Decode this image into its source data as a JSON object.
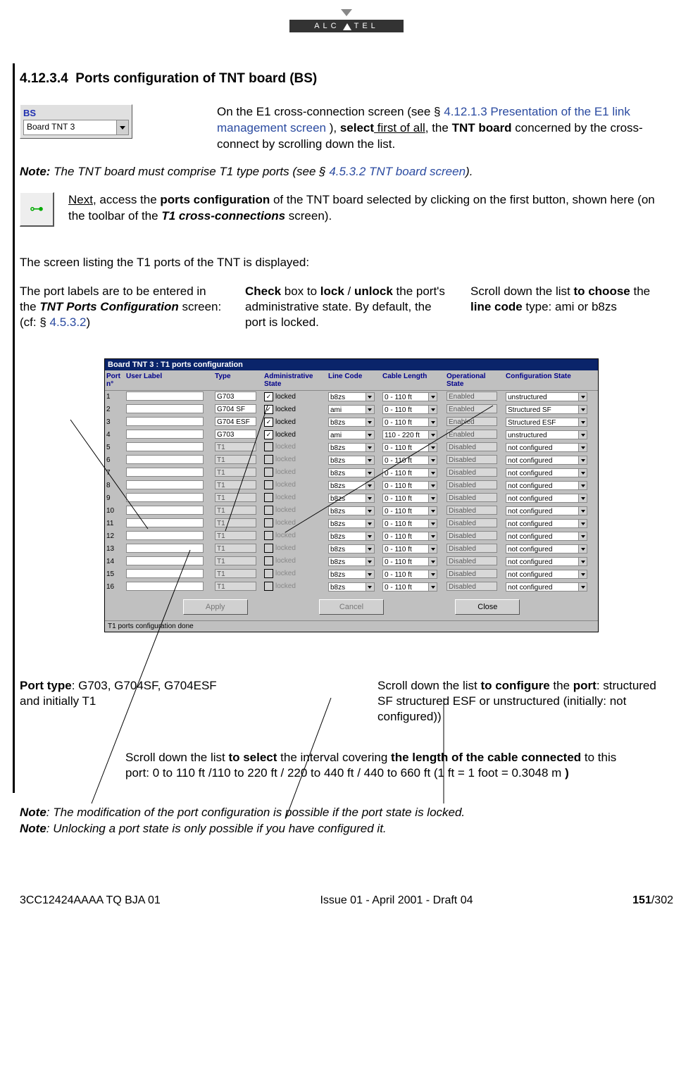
{
  "brand": {
    "letters_left": "ALC",
    "letters_right": "TEL"
  },
  "section_number": "4.12.3.4",
  "section_title": "Ports configuration of TNT board (BS)",
  "bs_box": {
    "header": "BS",
    "value": "Board TNT 3"
  },
  "intro": {
    "p1_a": "On the E1 cross-connection screen (see § ",
    "p1_link": "4.12.1.3 Presentation of the E1 link management screen ",
    "p1_b": "), ",
    "p1_bold_select": "select",
    "p1_under": " first of all",
    "p1_c": ", the ",
    "p1_bold_tnt": "TNT board",
    "p1_d": " concerned by the cross-connect by scrolling down the list."
  },
  "note1": {
    "label": "Note:",
    "body_a": "  The TNT board must comprise T1 type ports (see § ",
    "body_link": "4.5.3.2 TNT board screen",
    "body_b": ")."
  },
  "step2": {
    "under": "Next",
    "a": ", access the ",
    "b1": "ports configuration",
    "c": " of the TNT board selected by clicking on the first button, shown here (on the toolbar of the ",
    "b2": "T1 cross-connections",
    "d": " screen)."
  },
  "screen_intro": "The screen listing the T1 ports of the TNT is displayed:",
  "callouts": {
    "c1_a": "The port labels are to be entered in the ",
    "c1_b": "TNT Ports Configuration",
    "c1_c": " screen: (cf: § ",
    "c1_link": "4.5.3.2",
    "c1_d": ")",
    "c2_a": "Check",
    "c2_b": " box to ",
    "c2_c": "lock",
    "c2_d": " / ",
    "c2_e": "unlock",
    "c2_f": " the port's administrative state. By default, the port is locked.",
    "c3_a": "Scroll down the list ",
    "c3_b": "to choose",
    "c3_c": " the ",
    "c3_d": "line code",
    "c3_e": " type: ami or b8zs",
    "c4_a": "Port type",
    "c4_b": ": G703, G704SF, G704ESF and initially T1",
    "c5_a": "Scroll down the list ",
    "c5_b": "to configure",
    "c5_c": " the ",
    "c5_d": "port",
    "c5_e": ": structured SF structured ESF or unstructured (initially: not configured))",
    "c6_a": "Scroll down the list ",
    "c6_b": "to select",
    "c6_c": " the interval covering ",
    "c6_d": "the length of the cable connected",
    "c6_e": " to this port: 0 to 110 ft /110 to 220 ft / 220 to 440 ft / 440 to 660 ft (1 ft = 1 foot = 0.3048 m ",
    "c6_f": ")"
  },
  "window": {
    "title": "Board TNT 3 : T1 ports configuration",
    "headers": [
      "Port n°",
      "User Label",
      "Type",
      "Administrative State",
      "Line Code",
      "Cable Length",
      "Operational State",
      "Configuration State"
    ],
    "buttons": {
      "apply": "Apply",
      "cancel": "Cancel",
      "close": "Close"
    },
    "status": "T1 ports configuration done",
    "rows": [
      {
        "n": "1",
        "type": "G703",
        "locked": true,
        "lockLbl": "locked",
        "line": "b8zs",
        "cable": "0 - 110 ft",
        "op": "Enabled",
        "cfg": "unstructured"
      },
      {
        "n": "2",
        "type": "G704 SF",
        "locked": true,
        "lockLbl": "locked",
        "line": "ami",
        "cable": "0 - 110 ft",
        "op": "Enabled",
        "cfg": "Structured SF"
      },
      {
        "n": "3",
        "type": "G704 ESF",
        "locked": true,
        "lockLbl": "locked",
        "line": "b8zs",
        "cable": "0 - 110 ft",
        "op": "Enabled",
        "cfg": "Structured ESF"
      },
      {
        "n": "4",
        "type": "G703",
        "locked": true,
        "lockLbl": "locked",
        "line": "ami",
        "cable": "110 - 220 ft",
        "op": "Enabled",
        "cfg": "unstructured"
      },
      {
        "n": "5",
        "type": "T1",
        "locked": false,
        "lockLbl": "locked",
        "line": "b8zs",
        "cable": "0 - 110 ft",
        "op": "Disabled",
        "cfg": "not configured"
      },
      {
        "n": "6",
        "type": "T1",
        "locked": false,
        "lockLbl": "locked",
        "line": "b8zs",
        "cable": "0 - 110 ft",
        "op": "Disabled",
        "cfg": "not configured"
      },
      {
        "n": "7",
        "type": "T1",
        "locked": false,
        "lockLbl": "locked",
        "line": "b8zs",
        "cable": "0 - 110 ft",
        "op": "Disabled",
        "cfg": "not configured"
      },
      {
        "n": "8",
        "type": "T1",
        "locked": false,
        "lockLbl": "locked",
        "line": "b8zs",
        "cable": "0 - 110 ft",
        "op": "Disabled",
        "cfg": "not configured"
      },
      {
        "n": "9",
        "type": "T1",
        "locked": false,
        "lockLbl": "locked",
        "line": "b8zs",
        "cable": "0 - 110 ft",
        "op": "Disabled",
        "cfg": "not configured"
      },
      {
        "n": "10",
        "type": "T1",
        "locked": false,
        "lockLbl": "locked",
        "line": "b8zs",
        "cable": "0 - 110 ft",
        "op": "Disabled",
        "cfg": "not configured"
      },
      {
        "n": "11",
        "type": "T1",
        "locked": false,
        "lockLbl": "locked",
        "line": "b8zs",
        "cable": "0 - 110 ft",
        "op": "Disabled",
        "cfg": "not configured"
      },
      {
        "n": "12",
        "type": "T1",
        "locked": false,
        "lockLbl": "locked",
        "line": "b8zs",
        "cable": "0 - 110 ft",
        "op": "Disabled",
        "cfg": "not configured"
      },
      {
        "n": "13",
        "type": "T1",
        "locked": false,
        "lockLbl": "locked",
        "line": "b8zs",
        "cable": "0 - 110 ft",
        "op": "Disabled",
        "cfg": "not configured"
      },
      {
        "n": "14",
        "type": "T1",
        "locked": false,
        "lockLbl": "locked",
        "line": "b8zs",
        "cable": "0 - 110 ft",
        "op": "Disabled",
        "cfg": "not configured"
      },
      {
        "n": "15",
        "type": "T1",
        "locked": false,
        "lockLbl": "locked",
        "line": "b8zs",
        "cable": "0 - 110 ft",
        "op": "Disabled",
        "cfg": "not configured"
      },
      {
        "n": "16",
        "type": "T1",
        "locked": false,
        "lockLbl": "locked",
        "line": "b8zs",
        "cable": "0 - 110 ft",
        "op": "Disabled",
        "cfg": "not configured"
      }
    ]
  },
  "note2": {
    "label": "Note",
    "a": ": The modification of the port configuration is possible if the port state is locked.",
    "b": ": Unlocking a port state is only possible if you have configured it."
  },
  "footer": {
    "left": "3CC12424AAAA TQ BJA 01",
    "mid": "Issue 01 - April 2001 - Draft 04",
    "right_a": "151",
    "right_b": "/302"
  }
}
